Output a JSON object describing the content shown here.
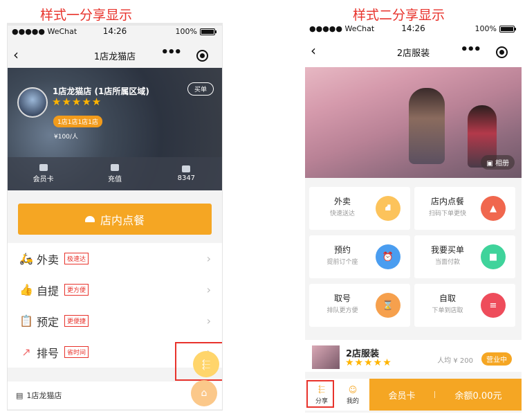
{
  "captions": {
    "style1": "样式一分享显示",
    "style2": "样式二分享显示"
  },
  "colors": {
    "accent": "#f5a623",
    "highlight": "#e8322b"
  },
  "status_bar": {
    "carrier": "●●●●● WeChat",
    "time": "14:26",
    "battery": "100%"
  },
  "phone1": {
    "nav_title": "1店龙猫店",
    "store_name": "1店龙猫店 (1店所属区域)",
    "stars": "★★★★★",
    "buy_button": "买单",
    "tag": "1店1店1店1店",
    "price": "¥100/人",
    "stats": [
      {
        "icon": "vip-card-icon",
        "label": "会员卡"
      },
      {
        "icon": "wallet-icon",
        "label": "充值"
      },
      {
        "icon": "coins-icon",
        "label": "8347"
      }
    ],
    "dine_in_button": "店内点餐",
    "menu": [
      {
        "icon": "scooter-icon",
        "glyph": "🛵",
        "label": "外卖",
        "badge": "极速达"
      },
      {
        "icon": "thumbs-up-icon",
        "glyph": "👍",
        "label": "自提",
        "badge": "更方便"
      },
      {
        "icon": "clipboard-icon",
        "glyph": "📋",
        "label": "预定",
        "badge": "更便捷"
      },
      {
        "icon": "queue-ticket-icon",
        "glyph": "↗",
        "label": "排号",
        "badge": "省时间"
      }
    ],
    "footer_store": "1店龙猫店"
  },
  "phone2": {
    "nav_title": "2店服装",
    "album_button": "相册",
    "services": [
      {
        "title": "外卖",
        "subtitle": "快速送达",
        "color": "#fcc35b",
        "icon": "scooter-icon"
      },
      {
        "title": "店内点餐",
        "subtitle": "扫码下单更快",
        "color": "#f0674e",
        "icon": "cloche-icon"
      },
      {
        "title": "预约",
        "subtitle": "提前订个座",
        "color": "#4a9df0",
        "icon": "alarm-clock-icon"
      },
      {
        "title": "我要买单",
        "subtitle": "当面付款",
        "color": "#3fd39b",
        "icon": "wallet-icon"
      },
      {
        "title": "取号",
        "subtitle": "排队更方便",
        "color": "#f6a04d",
        "icon": "hourglass-icon"
      },
      {
        "title": "自取",
        "subtitle": "下单到店取",
        "color": "#ee4c5b",
        "icon": "burger-icon"
      }
    ],
    "store_name": "2店服装",
    "stars": "★★★★★",
    "avg_price": "人均 ¥ 200",
    "open_badge": "营业中",
    "bottom": {
      "share_label": "分享",
      "mine_label": "我的",
      "vip_card": "会员卡",
      "balance": "余额0.00元"
    }
  }
}
